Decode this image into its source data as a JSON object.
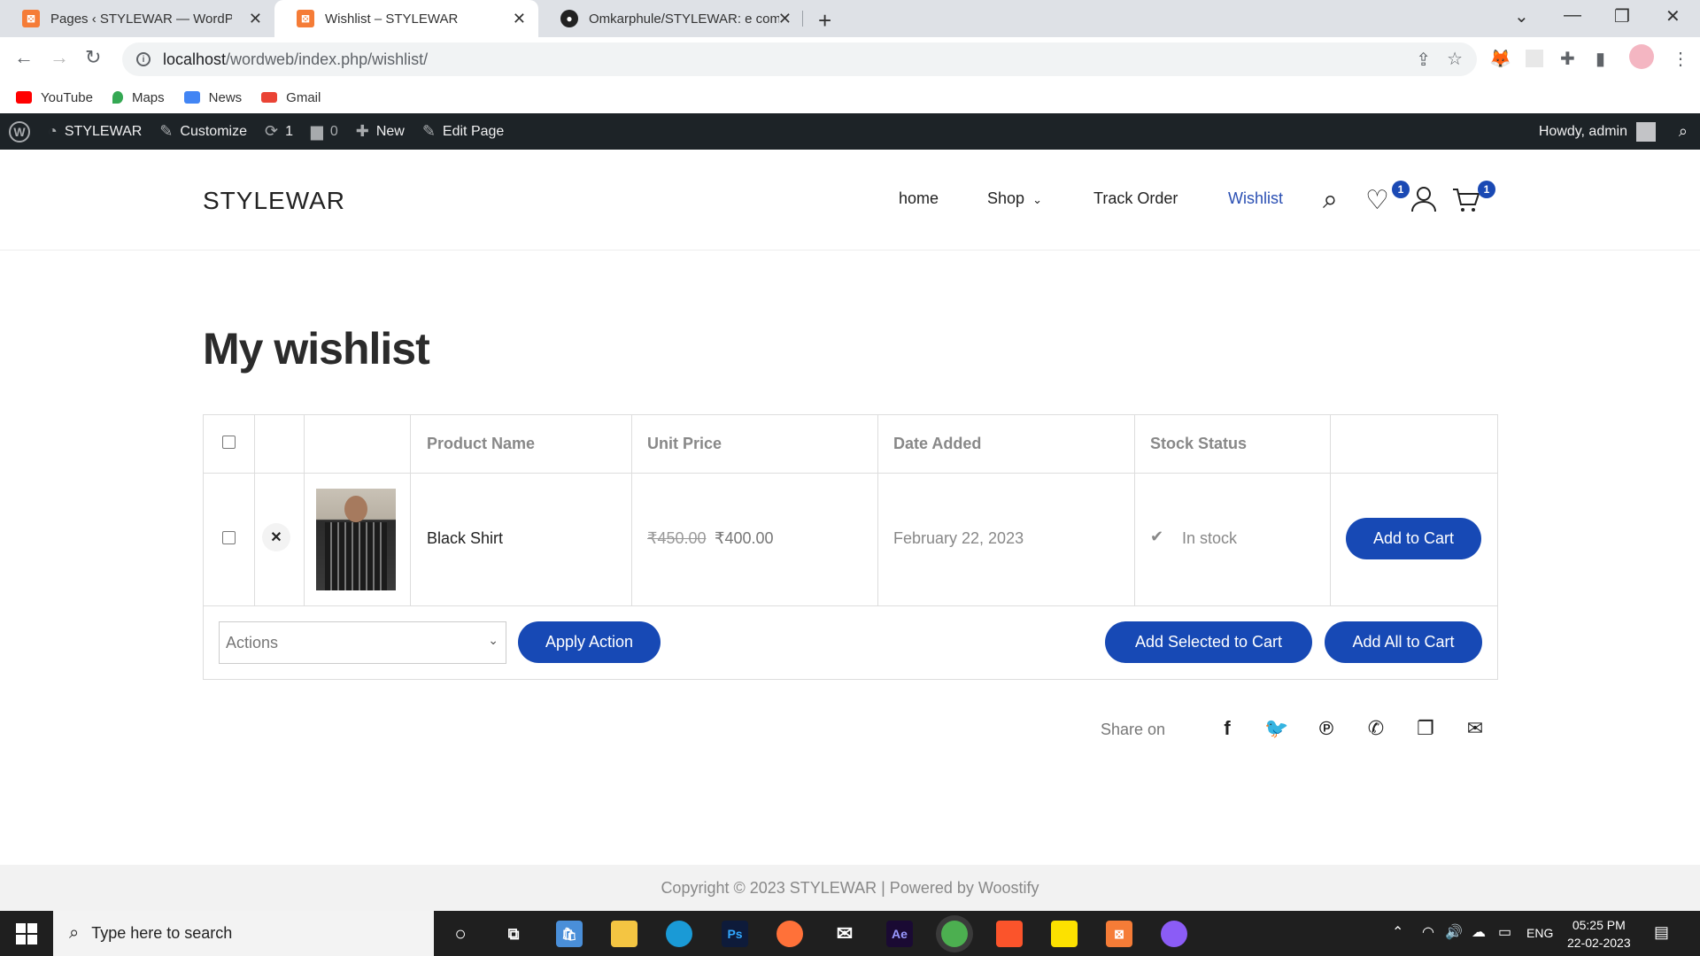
{
  "browser": {
    "tabs": [
      {
        "title": "Pages ‹ STYLEWAR — WordPress",
        "icon": "xampp-icon"
      },
      {
        "title": "Wishlist – STYLEWAR",
        "icon": "xampp-icon"
      },
      {
        "title": "Omkarphule/STYLEWAR: e comm",
        "icon": "github-icon"
      }
    ],
    "url_host": "localhost",
    "url_path": "/wordweb/index.php/wishlist/",
    "bookmarks": [
      "YouTube",
      "Maps",
      "News",
      "Gmail"
    ]
  },
  "wp_admin_bar": {
    "site": "STYLEWAR",
    "customize": "Customize",
    "updates": "1",
    "comments": "0",
    "new": "New",
    "edit_page": "Edit Page",
    "howdy": "Howdy, admin"
  },
  "site_header": {
    "logo": "STYLEWAR",
    "nav": [
      "home",
      "Shop",
      "Track Order",
      "Wishlist"
    ],
    "wishlist_count": "1",
    "cart_count": "1"
  },
  "main": {
    "title": "My wishlist",
    "columns": [
      "Product Name",
      "Unit Price",
      "Date Added",
      "Stock Status"
    ],
    "rows": [
      {
        "product": "Black Shirt",
        "old_price": "₹450.00",
        "price": "₹400.00",
        "date": "February 22, 2023",
        "stock": "In stock",
        "add_to_cart": "Add to Cart"
      }
    ],
    "actions_placeholder": "Actions",
    "apply_action": "Apply Action",
    "add_selected": "Add Selected to Cart",
    "add_all": "Add All to Cart",
    "share_on": "Share on"
  },
  "footer": {
    "text": "Copyright © 2023 STYLEWAR | Powered by Woostify"
  },
  "taskbar": {
    "search_placeholder": "Type here to search",
    "lang": "ENG",
    "time": "05:25 PM",
    "date": "22-02-2023"
  }
}
